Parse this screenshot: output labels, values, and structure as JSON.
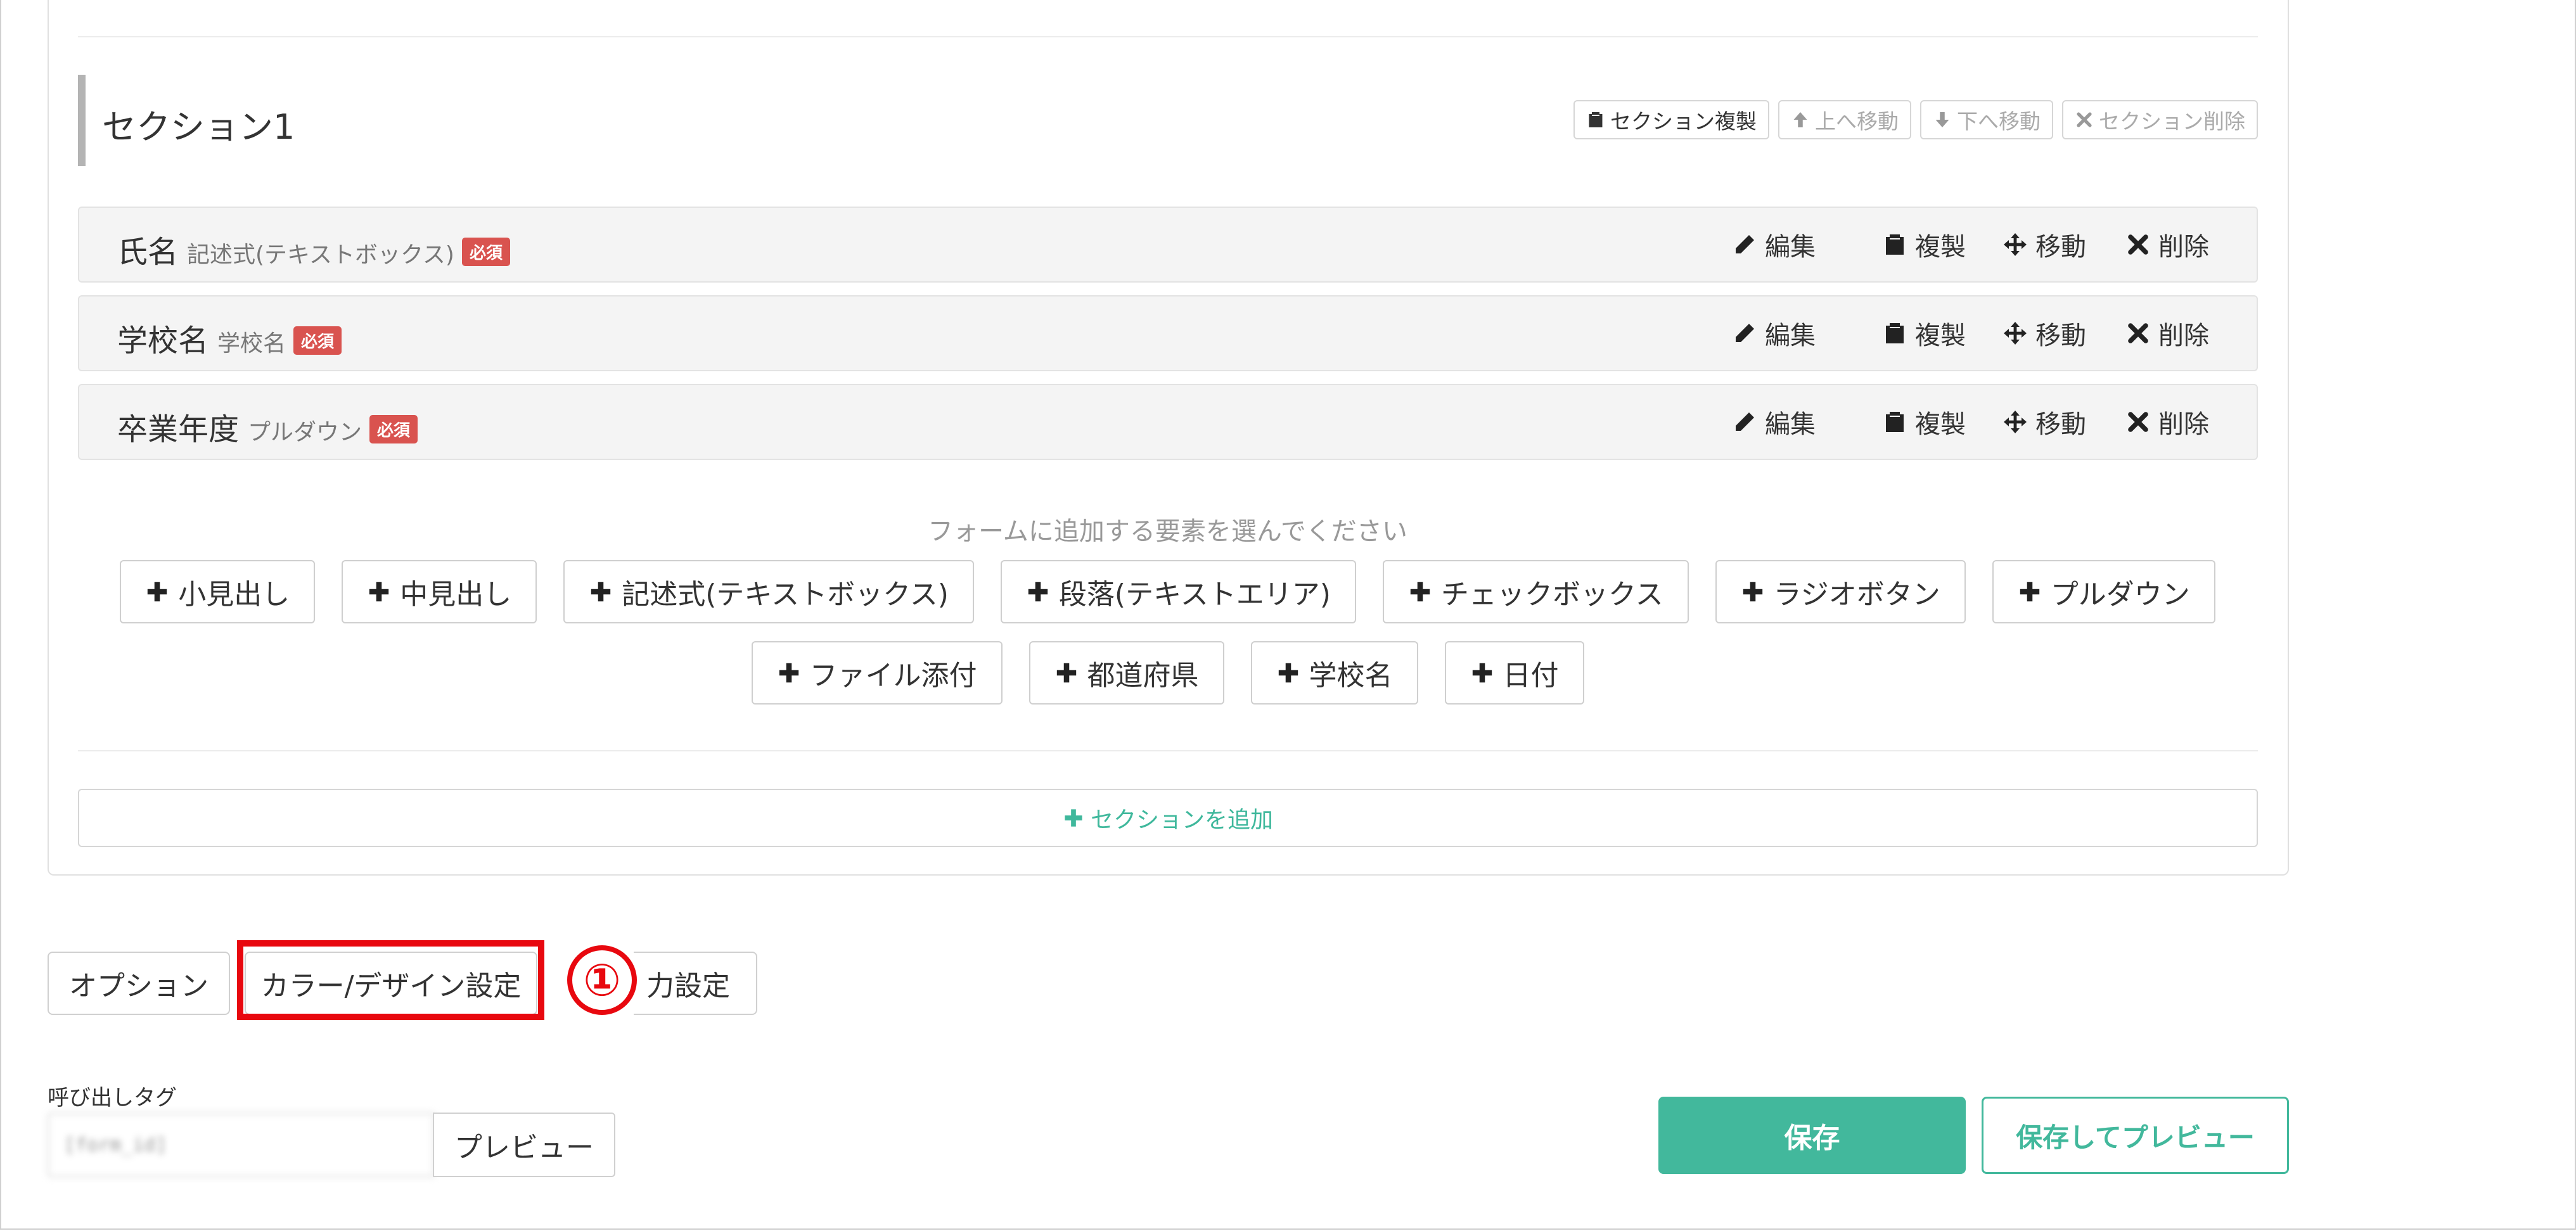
{
  "section": {
    "title": "セクション1",
    "actions": [
      {
        "label": "セクション複製",
        "icon": "clipboard-icon",
        "enabled": true
      },
      {
        "label": "上へ移動",
        "icon": "arrow-up-icon",
        "enabled": false
      },
      {
        "label": "下へ移動",
        "icon": "arrow-down-icon",
        "enabled": false
      },
      {
        "label": "セクション削除",
        "icon": "close-icon",
        "enabled": false
      }
    ]
  },
  "fields": [
    {
      "name": "氏名",
      "type": "記述式(テキストボックス)",
      "required": "必須"
    },
    {
      "name": "学校名",
      "type": "学校名",
      "required": "必須"
    },
    {
      "name": "卒業年度",
      "type": "プルダウン",
      "required": "必須"
    }
  ],
  "field_actions": {
    "edit": "編集",
    "duplicate": "複製",
    "move": "移動",
    "delete": "削除"
  },
  "add_prompt": "フォームに追加する要素を選んでください",
  "add_elements_row1": [
    "小見出し",
    "中見出し",
    "記述式(テキストボックス)",
    "段落(テキストエリア)",
    "チェックボックス",
    "ラジオボタン",
    "プルダウン"
  ],
  "add_elements_row2": [
    "ファイル添付",
    "都道府県",
    "学校名",
    "日付"
  ],
  "add_section": "セクションを追加",
  "tabs": {
    "options": "オプション",
    "color_design": "カラー/デザイン設定",
    "output": "力設定"
  },
  "annotation": {
    "number": "①",
    "color": "#e8080f"
  },
  "call_tag": {
    "label": "呼び出しタグ",
    "value": "[form_id]",
    "preview": "プレビュー"
  },
  "buttons": {
    "save": "保存",
    "save_preview": "保存してプレビュー"
  },
  "colors": {
    "accent": "#42b89c",
    "required_badge": "#d9534f",
    "highlight": "#e8080f"
  }
}
